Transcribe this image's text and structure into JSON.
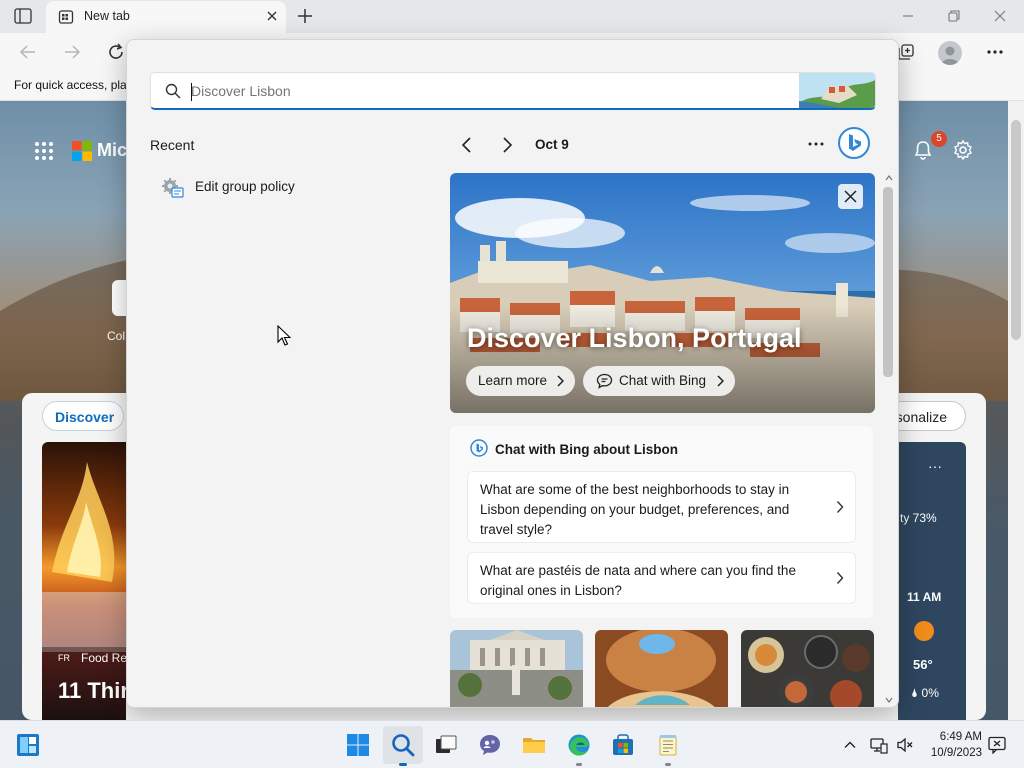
{
  "browser": {
    "tab_title": "New tab",
    "favorites_bar_text": "For quick access, pla"
  },
  "newtab": {
    "brand_partial": "Mic",
    "notification_count": "5",
    "quicklink_label": "Col",
    "discover_tab": "Discover",
    "personalize_button": "rsonalize",
    "feed_card": {
      "badge": "FR",
      "source": "Food Re",
      "title": "11 Thir"
    },
    "weather": {
      "more": "···",
      "humidity": "ty 73%",
      "time": "11 AM",
      "temperature": "56°",
      "precip": "🌢 0%"
    }
  },
  "search_flyout": {
    "search": {
      "value": "",
      "placeholder": "Discover Lisbon"
    },
    "recent": {
      "heading": "Recent",
      "items": [
        {
          "label": "Edit group policy",
          "icon": "group-policy-icon"
        }
      ]
    },
    "date_label": "Oct 9",
    "hero": {
      "title": "Discover Lisbon, Portugal",
      "learn_more": "Learn more",
      "chat_button": "Chat with Bing"
    },
    "chat_card": {
      "title": "Chat with Bing about Lisbon",
      "questions": [
        "What are some of the best neighborhoods to stay in Lisbon depending on your budget, preferences, and travel style?",
        "What are pastéis de nata and where can you find the original ones in Lisbon?"
      ]
    }
  },
  "taskbar": {
    "time": "6:49 AM",
    "date": "10/9/2023"
  },
  "colors": {
    "accent": "#0f6cbd",
    "bing_blue": "#2f88d9",
    "badge_red": "#d9472a"
  }
}
